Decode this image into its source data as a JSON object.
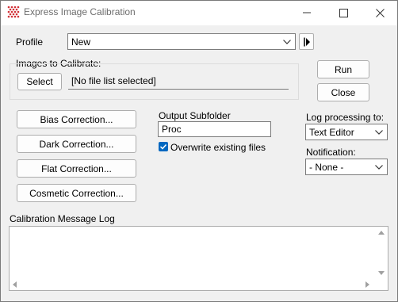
{
  "window": {
    "title": "Express Image Calibration",
    "brand_color": "#d23238"
  },
  "profile": {
    "label": "Profile",
    "value": "New"
  },
  "images": {
    "group_label": "Images to Calibrate:",
    "select_label": "Select",
    "file_list_text": "[No file list selected]"
  },
  "actions": {
    "run_label": "Run",
    "close_label": "Close"
  },
  "corrections": {
    "bias_label": "Bias Correction...",
    "dark_label": "Dark Correction...",
    "flat_label": "Flat Correction...",
    "cosmetic_label": "Cosmetic Correction..."
  },
  "output": {
    "label": "Output Subfolder",
    "value": "Proc",
    "overwrite_label": "Overwrite existing files",
    "overwrite_checked": true
  },
  "log_processing": {
    "label": "Log processing to:",
    "value": "Text Editor"
  },
  "notification": {
    "label": "Notification:",
    "value": "- None -"
  },
  "message_log": {
    "label": "Calibration Message Log",
    "content": ""
  },
  "accent_color": "#0067c0"
}
